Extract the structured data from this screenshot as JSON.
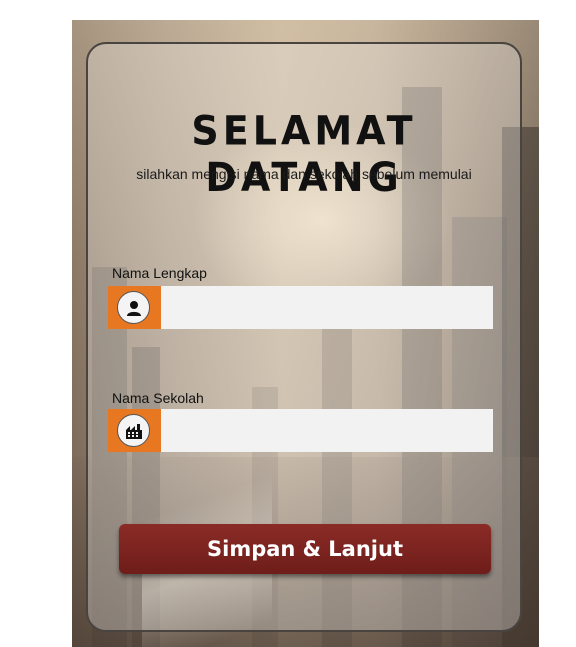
{
  "welcome": {
    "title": "SELAMAT DATANG",
    "subtitle": "silahkan mengisi nama dan sekolah sebelum memulai"
  },
  "form": {
    "full_name": {
      "label": "Nama Lengkap",
      "value": "",
      "icon": "user-icon"
    },
    "school_name": {
      "label": "Nama Sekolah",
      "value": "",
      "icon": "school-icon"
    },
    "submit_label": "Simpan & Lanjut"
  },
  "colors": {
    "icon_addon": "#e87722",
    "button": "#7a2420",
    "title_text": "#111111"
  }
}
